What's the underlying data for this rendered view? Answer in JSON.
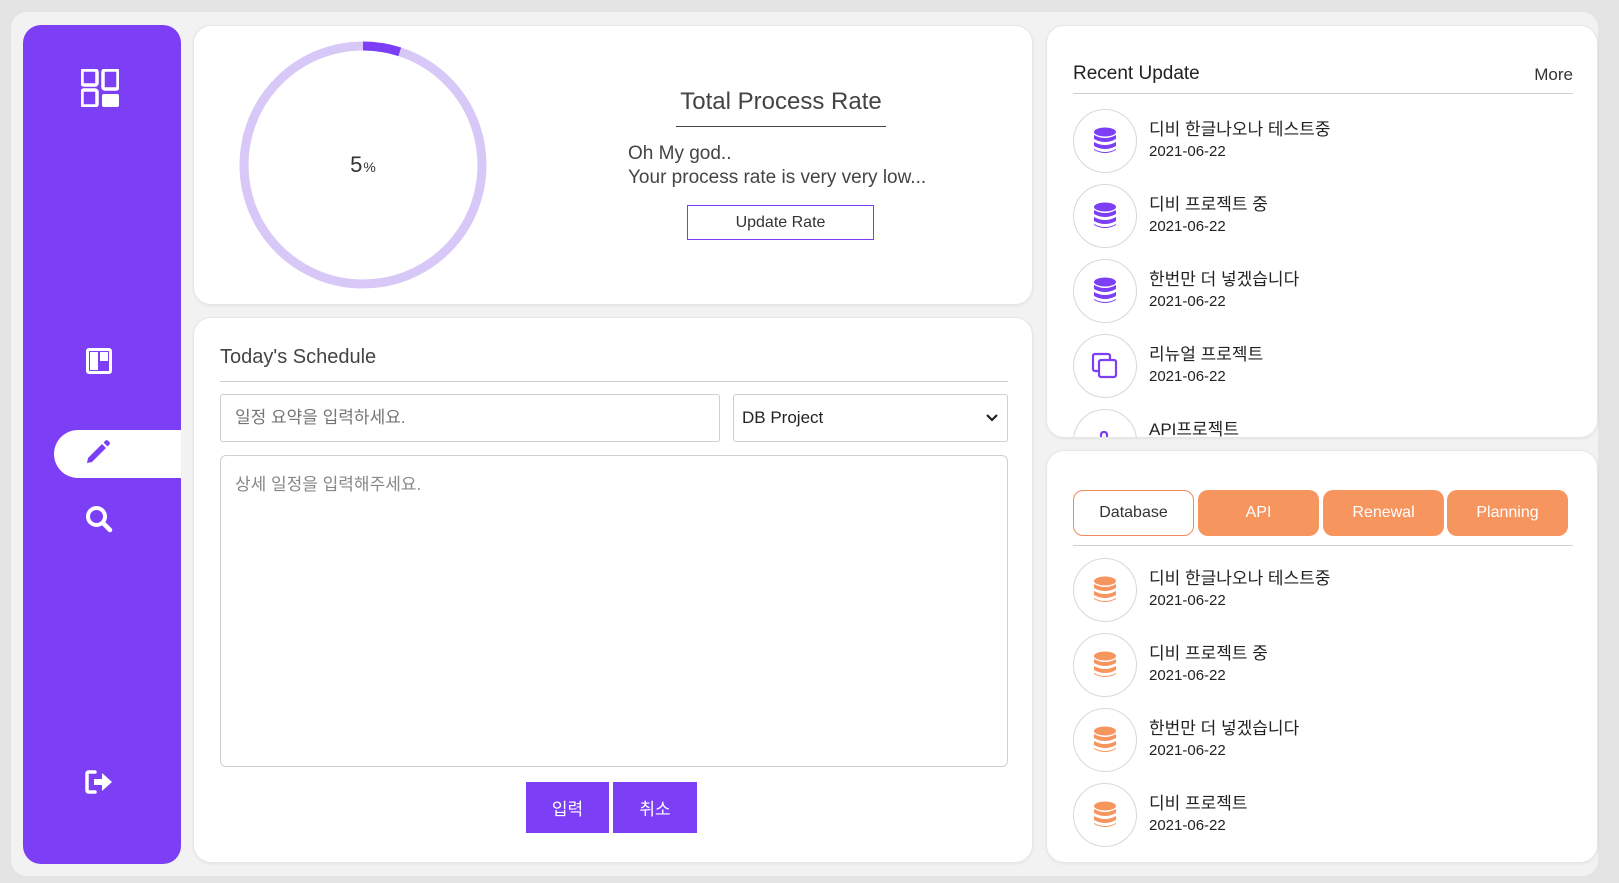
{
  "colors": {
    "accent": "#7c3ff5",
    "orange": "#f7955f",
    "ring_track": "#d7c8f7"
  },
  "sidebar": {
    "items": [
      {
        "icon": "dashboard-icon"
      },
      {
        "icon": "board-icon"
      },
      {
        "icon": "pencil-icon",
        "active": true
      },
      {
        "icon": "search-icon"
      },
      {
        "icon": "logout-icon"
      }
    ]
  },
  "process": {
    "value": "5",
    "unit": "%",
    "rate_fraction": 0.05,
    "title": "Total Process Rate",
    "message_line1": "Oh My god..",
    "message_line2": "Your process rate is very very low...",
    "update_button": "Update Rate"
  },
  "schedule": {
    "title": "Today's Schedule",
    "summary_placeholder": "일정 요약을 입력하세요.",
    "project_selected": "DB Project",
    "detail_placeholder": "상세 일정을 입력해주세요.",
    "submit_label": "입력",
    "cancel_label": "취소"
  },
  "recent": {
    "title": "Recent Update",
    "more_label": "More",
    "items": [
      {
        "icon": "database-icon",
        "title": "디비 한글나오나 테스트중",
        "date": "2021-06-22"
      },
      {
        "icon": "database-icon",
        "title": "디비 프로젝트 중",
        "date": "2021-06-22"
      },
      {
        "icon": "database-icon",
        "title": "한번만 더 넣겠습니다",
        "date": "2021-06-22"
      },
      {
        "icon": "copy-icon",
        "title": "리뉴얼 프로젝트",
        "date": "2021-06-22"
      },
      {
        "icon": "api-icon",
        "title": "API프로젝트",
        "date": ""
      }
    ]
  },
  "category": {
    "tabs": [
      "Database",
      "API",
      "Renewal",
      "Planning"
    ],
    "active_tab": "Database",
    "items": [
      {
        "icon": "database-icon",
        "title": "디비 한글나오나 테스트중",
        "date": "2021-06-22"
      },
      {
        "icon": "database-icon",
        "title": "디비 프로젝트 중",
        "date": "2021-06-22"
      },
      {
        "icon": "database-icon",
        "title": "한번만 더 넣겠습니다",
        "date": "2021-06-22"
      },
      {
        "icon": "database-icon",
        "title": "디비 프로젝트",
        "date": "2021-06-22"
      }
    ]
  }
}
